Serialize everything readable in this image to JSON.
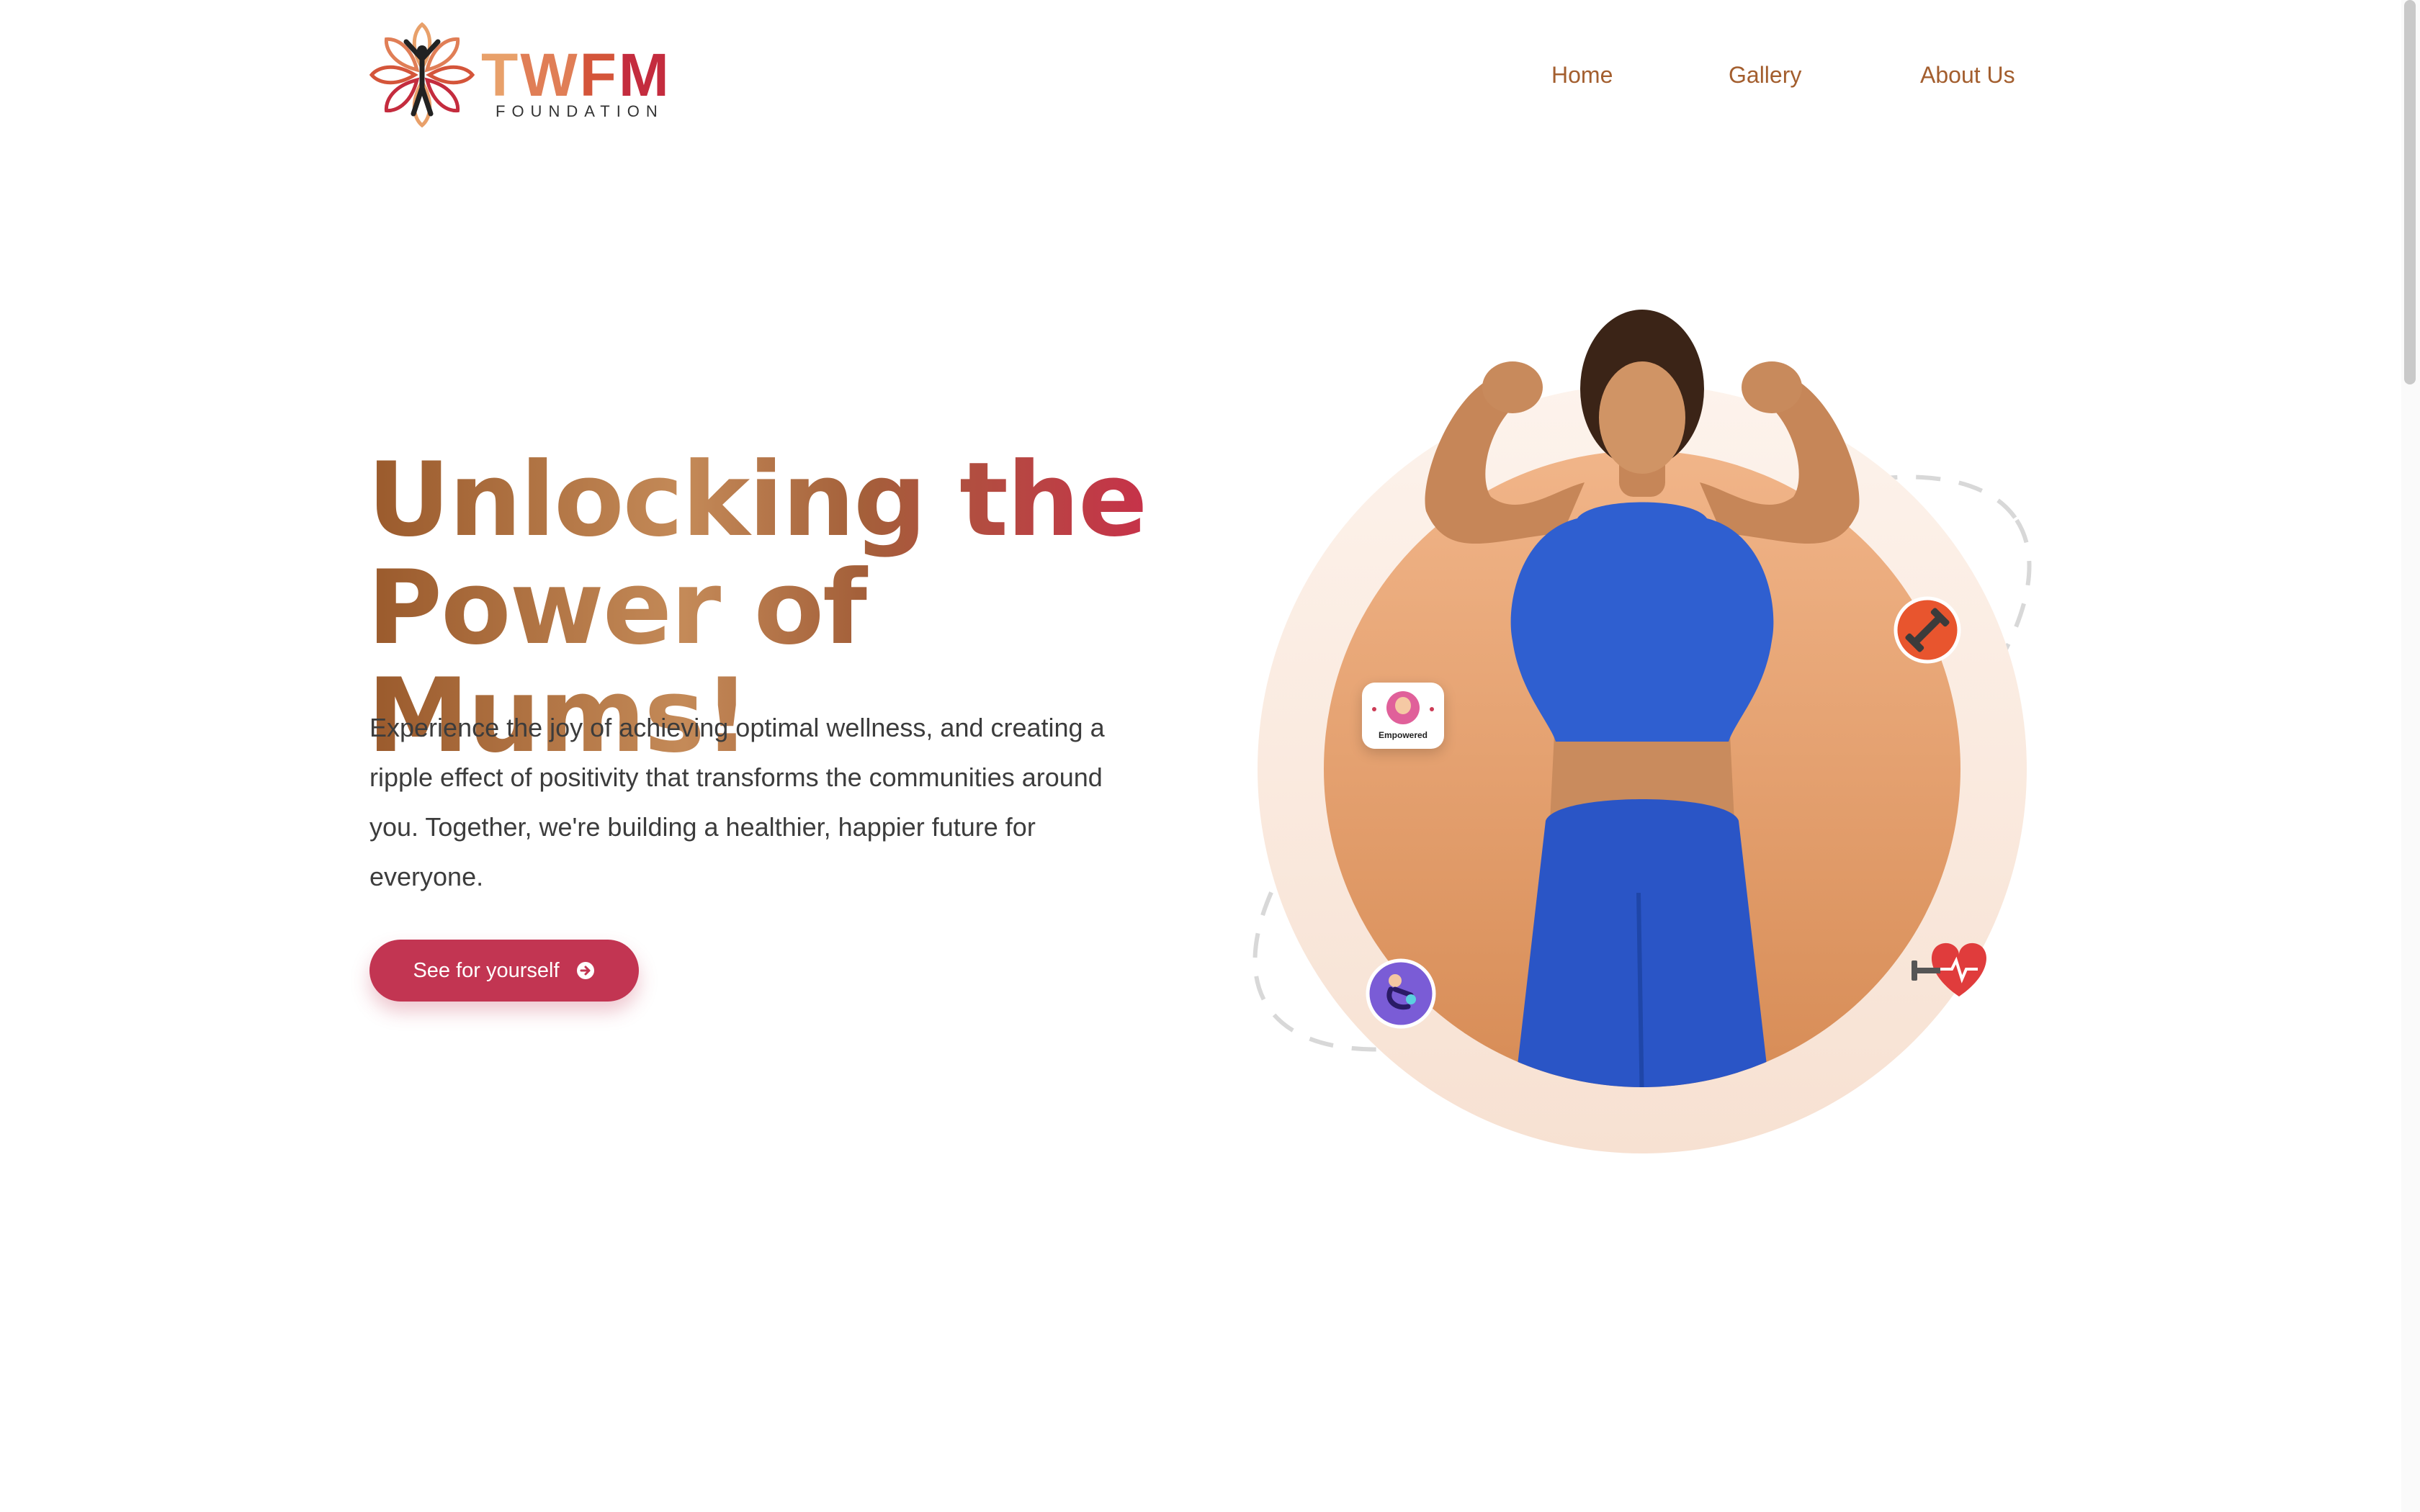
{
  "header": {
    "logo": {
      "letters": [
        "T",
        "W",
        "F",
        "M"
      ],
      "subtitle": "FOUNDATION"
    },
    "nav": [
      {
        "label": "Home"
      },
      {
        "label": "Gallery"
      },
      {
        "label": "About Us"
      }
    ]
  },
  "hero": {
    "headline_line1": "Unlocking the",
    "headline_line2": "Power of Mums!",
    "lead": "Experience the joy of achieving optimal wellness, and creating a ripple effect of positivity that transforms the communities around you. Together, we're building a healthier, happier future for everyone.",
    "cta_label": "See for yourself",
    "cta_icon": "arrow-right-circle-icon"
  },
  "illustration": {
    "badge_label": "Empowered",
    "icons": [
      "dumbbell-icon",
      "heart-rate-icon",
      "yoga-icon",
      "empowered-badge-icon"
    ]
  },
  "colors": {
    "brand_red": "#c23552",
    "brand_brown": "#a35e2e",
    "circle_orange": "#eba77a",
    "outfit_blue": "#2f5fd0"
  }
}
